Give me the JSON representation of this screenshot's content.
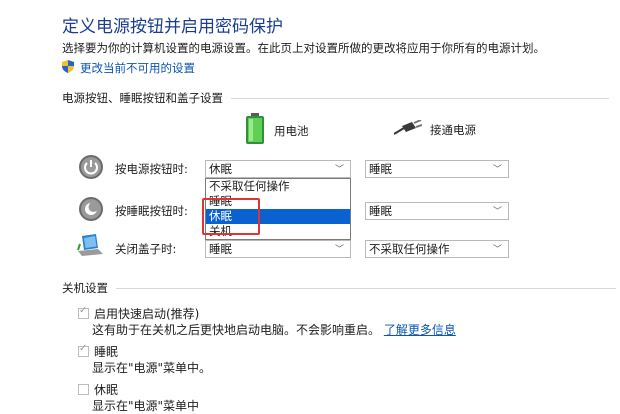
{
  "header": {
    "title": "定义电源按钮并启用密码保护",
    "description": "选择要为你的计算机设置的电源设置。在此页上对设置所做的更改将应用于你所有的电源计划。",
    "change_settings_link": "更改当前不可用的设置"
  },
  "power_section": {
    "heading": "电源按钮、睡眠按钮和盖子设置",
    "columns": [
      {
        "label": "用电池",
        "icon": "battery-icon"
      },
      {
        "label": "接通电源",
        "icon": "power-plug-icon"
      }
    ],
    "rows": [
      {
        "label": "按电源按钮时:",
        "icon": "power-button-icon",
        "battery_value": "休眠",
        "plugged_value": "睡眠"
      },
      {
        "label": "按睡眠按钮时:",
        "icon": "sleep-button-icon",
        "battery_value": "睡眠",
        "plugged_value": "睡眠"
      },
      {
        "label": "关闭盖子时:",
        "icon": "laptop-lid-icon",
        "battery_value": "睡眠",
        "plugged_value": "不采取任何操作"
      }
    ],
    "open_dropdown": {
      "options": [
        "不采取任何操作",
        "睡眠",
        "休眠",
        "关机"
      ],
      "selected": "休眠"
    }
  },
  "shutdown_section": {
    "heading": "关机设置",
    "items": [
      {
        "label": "启用快速启动(推荐)",
        "checked": true,
        "description": "这有助于在关机之后更快地启动电脑。不会影响重启。",
        "link": "了解更多信息"
      },
      {
        "label": "睡眠",
        "checked": true,
        "description": "显示在\"电源\"菜单中。"
      },
      {
        "label": "休眠",
        "checked": false,
        "description": "显示在\"电源\"菜单中"
      }
    ]
  },
  "colors": {
    "title": "#1a3d8f",
    "link": "#0a56b0",
    "selection": "#0a62d0",
    "highlight_box": "#e03434"
  }
}
